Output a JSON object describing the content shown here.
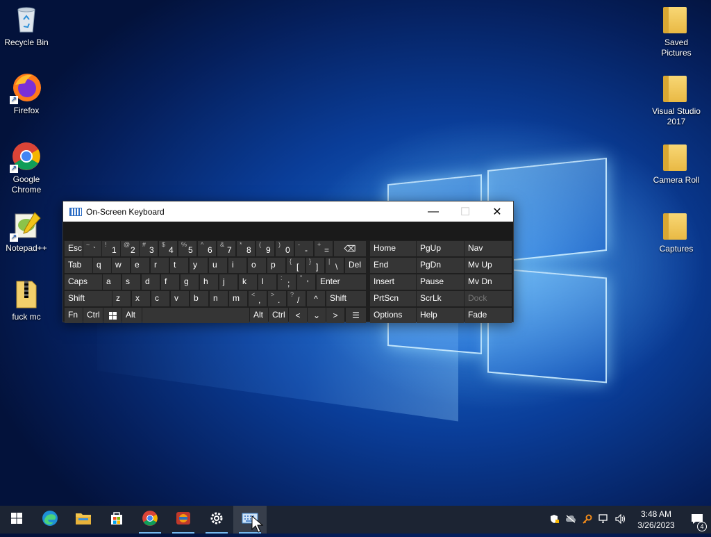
{
  "desktop": {
    "icons_left": [
      {
        "label": "Recycle Bin"
      },
      {
        "label": "Firefox"
      },
      {
        "label": "Google Chrome"
      },
      {
        "label": "Notepad++"
      },
      {
        "label": "fuck mc"
      }
    ],
    "icons_right": [
      {
        "label": "Saved Pictures"
      },
      {
        "label": "Visual Studio 2017"
      },
      {
        "label": "Camera Roll"
      },
      {
        "label": "Captures"
      }
    ]
  },
  "osk": {
    "title": "On-Screen Keyboard",
    "keys": {
      "esc": "Esc",
      "tilde_sub": "~",
      "tilde": "`",
      "n1s": "!",
      "n1": "1",
      "n2s": "@",
      "n2": "2",
      "n3s": "#",
      "n3": "3",
      "n4s": "$",
      "n4": "4",
      "n5s": "%",
      "n5": "5",
      "n6s": "^",
      "n6": "6",
      "n7s": "&",
      "n7": "7",
      "n8s": "*",
      "n8": "8",
      "n9s": "(",
      "n9": "9",
      "n0s": ")",
      "n0": "0",
      "minus_s": "-",
      "minus": "-",
      "plus_s": "+",
      "plus": "=",
      "backspace": "⌫",
      "tab": "Tab",
      "q": "q",
      "w": "w",
      "e": "e",
      "r": "r",
      "t": "t",
      "y": "y",
      "u": "u",
      "i": "i",
      "o": "o",
      "p": "p",
      "lbr_s": "{",
      "lbr": "[",
      "rbr_s": "}",
      "rbr": "]",
      "bsl_s": "|",
      "bsl": "\\",
      "del": "Del",
      "caps": "Caps",
      "a": "a",
      "s": "s",
      "d": "d",
      "f": "f",
      "g": "g",
      "h": "h",
      "j": "j",
      "k": "k",
      "l": "l",
      "semi_s": ":",
      "semi": ";",
      "quote_s": "\"",
      "quote": "'",
      "enter": "Enter",
      "shift_l": "Shift",
      "z": "z",
      "x": "x",
      "c": "c",
      "v": "v",
      "b": "b",
      "n": "n",
      "m": "m",
      "comma_s": "<",
      "comma": ",",
      "period_s": ">",
      "period": ".",
      "slash_s": "?",
      "slash": "/",
      "up": "^",
      "shift_r": "Shift",
      "fn": "Fn",
      "ctrl_l": "Ctrl",
      "alt_l": "Alt",
      "alt_r": "Alt",
      "ctrl_r": "Ctrl",
      "left": "<",
      "down": "⌄",
      "right": ">",
      "menu": "☰"
    },
    "nav": [
      [
        "Home",
        "PgUp",
        "Nav"
      ],
      [
        "End",
        "PgDn",
        "Mv Up"
      ],
      [
        "Insert",
        "Pause",
        "Mv Dn"
      ],
      [
        "PrtScn",
        "ScrLk",
        "Dock"
      ],
      [
        "Options",
        "Help",
        "Fade"
      ]
    ]
  },
  "taskbar": {
    "time": "3:48 AM",
    "date": "3/26/2023",
    "notifications": "4"
  },
  "colors": {
    "taskbar": "#1c2433",
    "accent": "#76b9ed"
  }
}
